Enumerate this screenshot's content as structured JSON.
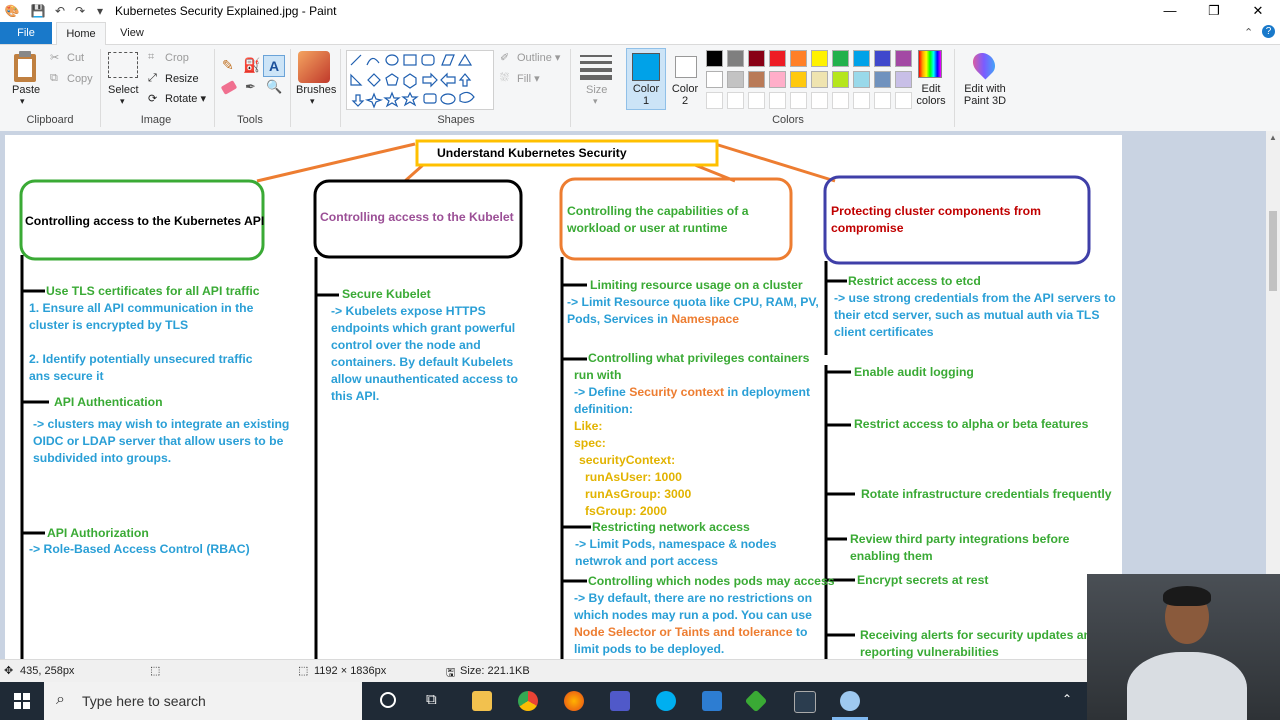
{
  "window": {
    "title": "Kubernetes Security Explained.jpg - Paint",
    "minimize": "—",
    "maximize": "❐",
    "close": "✕"
  },
  "tabs": [
    "File",
    "Home",
    "View"
  ],
  "ribbon": {
    "clipboard": {
      "paste": "Paste",
      "cut": "Cut",
      "copy": "Copy",
      "label": "Clipboard"
    },
    "image": {
      "select": "Select",
      "crop": "Crop",
      "resize": "Resize",
      "rotate": "Rotate",
      "label": "Image"
    },
    "tools": {
      "label": "Tools"
    },
    "brushes": "Brushes",
    "shapes": {
      "outline": "Outline",
      "fill": "Fill",
      "label": "Shapes"
    },
    "size": "Size",
    "color1": "Color 1",
    "color2": "Color 2",
    "colors_label": "Colors",
    "edit_colors": "Edit colors",
    "paint3d": "Edit with Paint 3D",
    "palette_row1": [
      "#000000",
      "#7f7f7f",
      "#880015",
      "#ed1c24",
      "#ff7f27",
      "#fff200",
      "#22b14c",
      "#00a2e8",
      "#3f48cc",
      "#a349a4"
    ],
    "palette_row2": [
      "#ffffff",
      "#c3c3c3",
      "#b97a57",
      "#ffaec9",
      "#ffc90e",
      "#efe4b0",
      "#b5e61d",
      "#99d9ea",
      "#7092be",
      "#c8bfe7"
    ],
    "color1_value": "#00a2e8"
  },
  "diagram": {
    "title": "Understand Kubernetes Security",
    "col1": {
      "heading": "Controlling access to the Kubernetes API",
      "l1": "Use TLS certificates for all API traffic",
      "l2": "1. Ensure all API communication in the",
      "l3": "cluster is encrypted by TLS",
      "l4": "2. Identify potentially unsecured traffic",
      "l5": "ans secure it",
      "l6": "API Authentication",
      "l7": "-> clusters may wish to integrate an existing",
      "l8": "OIDC or LDAP server that allow users to be",
      "l9": "subdivided into groups.",
      "l10": "API Authorization",
      "l11": "-> Role-Based Access Control (RBAC)"
    },
    "col2": {
      "heading": "Controlling access to the Kubelet",
      "l1": "Secure Kubelet",
      "l2": "-> Kubelets expose HTTPS",
      "l3": "endpoints which grant powerful",
      "l4": "control over the node and",
      "l5": "containers. By default Kubelets",
      "l6": "allow unauthenticated access to",
      "l7": "this API."
    },
    "col3": {
      "heading1": "Controlling the capabilities of a",
      "heading2": "workload or user at runtime",
      "l1": "Limiting resource usage on a cluster",
      "l2": "-> Limit Resource quota like CPU, RAM, PV,",
      "l3a": "Pods, Services in ",
      "l3b": "Namespace",
      "l4": "Controlling what privileges containers",
      "l5": "run with",
      "l6a": "-> Define ",
      "l6b": "Security context",
      "l6c": " in deployment",
      "l7": "definition:",
      "l8": "Like:",
      "l9": "spec:",
      "l10": "securityContext:",
      "l11": "runAsUser: 1000",
      "l12": "runAsGroup: 3000",
      "l13": "fsGroup: 2000",
      "l14": "Restricting network access",
      "l15": "-> Limit Pods, namespace & nodes",
      "l16": "netwrok and port access",
      "l17": "Controlling which nodes pods may access",
      "l18": "-> By default, there are no restrictions on",
      "l19": "which nodes may run a pod. You can use",
      "l20a": "Node Selector or Taints and tolerance",
      "l20b": " to",
      "l21": "limit pods to be deployed."
    },
    "col4": {
      "heading1": "Protecting cluster components from",
      "heading2": "compromise",
      "l1": "Restrict access to etcd",
      "l2": "-> use strong credentials from the API servers to",
      "l3": "their etcd server, such as mutual auth via TLS",
      "l4": "client certificates",
      "l5": "Enable audit logging",
      "l6": "Restrict access to alpha or beta features",
      "l7": "Rotate infrastructure credentials frequently",
      "l8": "Review third party integrations before",
      "l9": "enabling them",
      "l10": "Encrypt secrets at rest",
      "l11": "Receiving alerts for security updates an",
      "l12": "reporting vulnerabilities"
    }
  },
  "status": {
    "cursor": "435, 258px",
    "dimensions": "1192 × 1836px",
    "size": "Size: 221.1KB"
  },
  "taskbar": {
    "search_placeholder": "Type here to search"
  }
}
